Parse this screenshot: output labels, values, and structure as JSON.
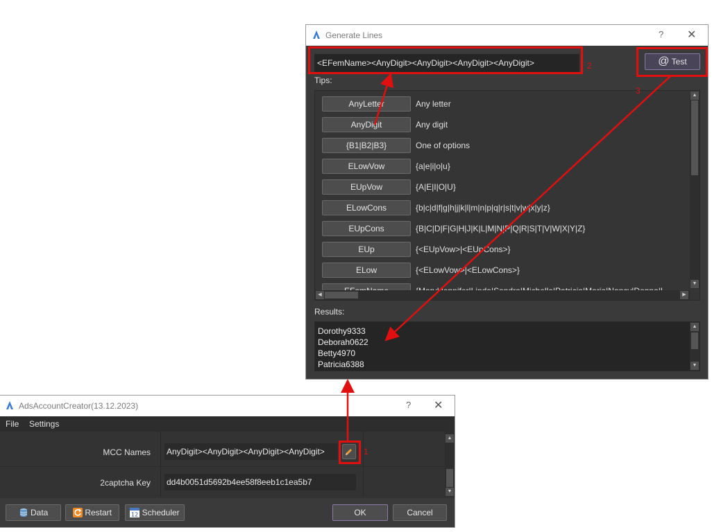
{
  "gen": {
    "title": "Generate Lines",
    "help": "?",
    "close": "✕",
    "pattern": "<EFemName><AnyDigit><AnyDigit><AnyDigit><AnyDigit>",
    "test_label": "Test",
    "tips_label": "Tips:",
    "tips": [
      {
        "btn": "AnyLetter",
        "desc": "Any letter"
      },
      {
        "btn": "AnyDigit",
        "desc": "Any digit"
      },
      {
        "btn": "{B1|B2|B3}",
        "desc": "One of options"
      },
      {
        "btn": "ELowVow",
        "desc": "{a|e|i|o|u}"
      },
      {
        "btn": "EUpVow",
        "desc": "{A|E|I|O|U}"
      },
      {
        "btn": "ELowCons",
        "desc": "{b|c|d|f|g|h|j|k|l|m|n|p|q|r|s|t|v|w|x|y|z}"
      },
      {
        "btn": "EUpCons",
        "desc": "{B|C|D|F|G|H|J|K|L|M|N|P|Q|R|S|T|V|W|X|Y|Z}"
      },
      {
        "btn": "EUp",
        "desc": "{<EUpVow>|<EUpCons>}"
      },
      {
        "btn": "ELow",
        "desc": "{<ELowVow>|<ELowCons>}"
      },
      {
        "btn": "EFemName",
        "desc": "{Mary|Jennifer|Linda|Sandra|Michelle|Patricia|Maria|Nancy|Donna|L"
      }
    ],
    "results_label": "Results:",
    "results": [
      "Dorothy9333",
      "Deborah0622",
      "Betty4970",
      "Patricia6388"
    ]
  },
  "main": {
    "title": "AdsAccountCreator(13.12.2023)",
    "help": "?",
    "close": "✕",
    "menu": [
      "File",
      "Settings"
    ],
    "rows": [
      {
        "label": "MCC Names",
        "value": "AnyDigit><AnyDigit><AnyDigit><AnyDigit>"
      },
      {
        "label": "2captcha Key",
        "value": "dd4b0051d5692b4ee58f8eeb1c1ea5b7"
      }
    ],
    "buttons": {
      "data": "Data",
      "restart": "Restart",
      "scheduler": "Scheduler",
      "ok": "OK",
      "cancel": "Cancel"
    }
  },
  "annotations": [
    "1",
    "2",
    "3"
  ],
  "colors": {
    "highlight": "#e01010",
    "window_bg": "#3a3a3a",
    "field_bg": "#252525"
  }
}
